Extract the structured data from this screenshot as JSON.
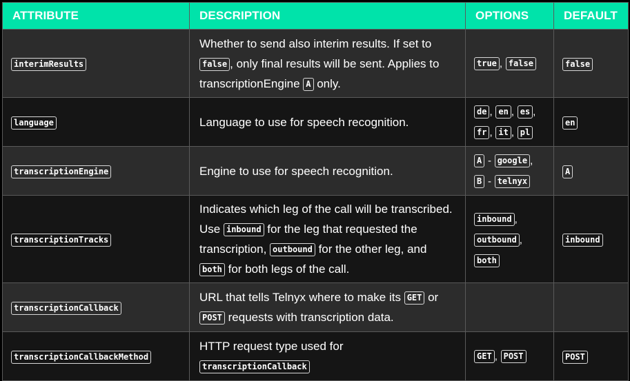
{
  "headers": {
    "attribute": "ATTRIBUTE",
    "description": "DESCRIPTION",
    "options": "OPTIONS",
    "default": "DEFAULT"
  },
  "rows": [
    {
      "attribute": "interimResults",
      "desc": {
        "t1": "Whether to send also interim results. If set to ",
        "c1": "false",
        "t2": ", only final results will be sent. Applies to transcriptionEngine ",
        "c2": "A",
        "t3": " only."
      },
      "options": [
        "true",
        "false"
      ],
      "default": "false"
    },
    {
      "attribute": "language",
      "desc": {
        "t1": "Language to use for speech recognition."
      },
      "options": [
        "de",
        "en",
        "es",
        "fr",
        "it",
        "pl"
      ],
      "default": "en"
    },
    {
      "attribute": "transcriptionEngine",
      "desc": {
        "t1": "Engine to use for speech recognition."
      },
      "options": [
        "A",
        "google",
        "B",
        "telnyx"
      ],
      "option_dash": "-",
      "default": "A"
    },
    {
      "attribute": "transcriptionTracks",
      "desc": {
        "t1": "Indicates which leg of the call will be transcribed. Use ",
        "c1": "inbound",
        "t2": " for the leg that requested the transcription, ",
        "c2": "outbound",
        "t3": " for the other leg, and ",
        "c3": "both",
        "t4": " for both legs of the call."
      },
      "options": [
        "inbound",
        "outbound",
        "both"
      ],
      "default": "inbound"
    },
    {
      "attribute": "transcriptionCallback",
      "desc": {
        "t1": "URL that tells Telnyx where to make its ",
        "c1": "GET",
        "t2": " or ",
        "c2": "POST",
        "t3": " requests with transcription data."
      },
      "options": [],
      "default": ""
    },
    {
      "attribute": "transcriptionCallbackMethod",
      "desc": {
        "t1": "HTTP request type used for ",
        "c1": "transcriptionCallback"
      },
      "options": [
        "GET",
        "POST"
      ],
      "default": "POST"
    }
  ],
  "punct": {
    "comma": ",",
    "space": " "
  },
  "colors": {
    "header_bg": "#00e3aa",
    "row_odd": "#2c2c2c",
    "row_even": "#151515",
    "border": "#5a5a5a"
  }
}
